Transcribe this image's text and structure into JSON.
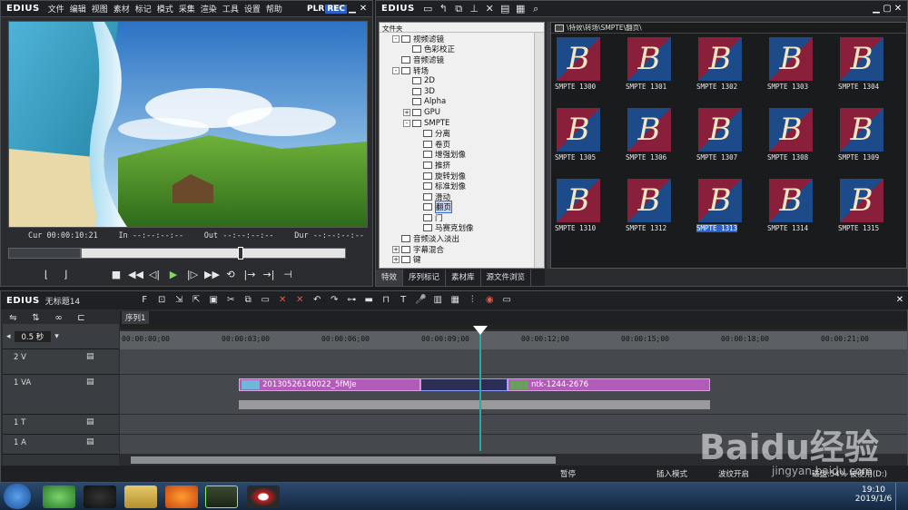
{
  "player": {
    "logo": "EDIUS",
    "menu": [
      "文件",
      "编辑",
      "视图",
      "素材",
      "标记",
      "模式",
      "采集",
      "渲染",
      "工具",
      "设置",
      "帮助"
    ],
    "plr": "PLR",
    "rec": "REC",
    "cur_label": "Cur",
    "cur_value": "00:00:10:21",
    "in_label": "In",
    "in_value": "--:--:--:--",
    "out_label": "Out",
    "out_value": "--:--:--:--",
    "dur_label": "Dur",
    "dur_value": "--:--:--:--",
    "scrub_position": 0.6
  },
  "bin": {
    "logo": "EDIUS",
    "tree_header": "文件夹",
    "path": "\\特效\\转场\\SMPTE\\翻页\\",
    "tree": [
      {
        "label": "视频滤镜",
        "level": 1,
        "exp": "-"
      },
      {
        "label": "色彩校正",
        "level": 2,
        "exp": ""
      },
      {
        "label": "音频滤镜",
        "level": 1,
        "exp": ""
      },
      {
        "label": "转场",
        "level": 1,
        "exp": "-"
      },
      {
        "label": "2D",
        "level": 2,
        "exp": ""
      },
      {
        "label": "3D",
        "level": 2,
        "exp": ""
      },
      {
        "label": "Alpha",
        "level": 2,
        "exp": ""
      },
      {
        "label": "GPU",
        "level": 2,
        "exp": "+"
      },
      {
        "label": "SMPTE",
        "level": 2,
        "exp": "-"
      },
      {
        "label": "分离",
        "level": 3,
        "exp": ""
      },
      {
        "label": "卷页",
        "level": 3,
        "exp": ""
      },
      {
        "label": "增强划像",
        "level": 3,
        "exp": ""
      },
      {
        "label": "推挤",
        "level": 3,
        "exp": ""
      },
      {
        "label": "旋转划像",
        "level": 3,
        "exp": ""
      },
      {
        "label": "标准划像",
        "level": 3,
        "exp": ""
      },
      {
        "label": "滑动",
        "level": 3,
        "exp": ""
      },
      {
        "label": "翻页",
        "level": 3,
        "exp": "",
        "selected": true
      },
      {
        "label": "门",
        "level": 3,
        "exp": ""
      },
      {
        "label": "马赛克划像",
        "level": 3,
        "exp": ""
      },
      {
        "label": "音频淡入淡出",
        "level": 1,
        "exp": ""
      },
      {
        "label": "字幕混合",
        "level": 1,
        "exp": "+"
      },
      {
        "label": "键",
        "level": 1,
        "exp": "+"
      }
    ],
    "tabs": [
      "特效",
      "序列标记",
      "素材库",
      "源文件浏览"
    ],
    "items": [
      {
        "label": "SMPTE 1300",
        "bg": "#1d4b8a",
        "fg": "#8a1f3c"
      },
      {
        "label": "SMPTE 1301",
        "bg": "#8a1f3c",
        "fg": "#1d4b8a"
      },
      {
        "label": "SMPTE 1302",
        "bg": "#8a1f3c",
        "fg": "#1d4b8a"
      },
      {
        "label": "SMPTE 1303",
        "bg": "#1d4b8a",
        "fg": "#8a1f3c"
      },
      {
        "label": "SMPTE 1304",
        "bg": "#8a1f3c",
        "fg": "#1d4b8a"
      },
      {
        "label": "SMPTE 1305",
        "bg": "#8a1f3c",
        "fg": "#1d4b8a"
      },
      {
        "label": "SMPTE 1306",
        "bg": "#1d4b8a",
        "fg": "#8a1f3c"
      },
      {
        "label": "SMPTE 1307",
        "bg": "#8a1f3c",
        "fg": "#1d4b8a"
      },
      {
        "label": "SMPTE 1308",
        "bg": "#1d4b8a",
        "fg": "#8a1f3c"
      },
      {
        "label": "SMPTE 1309",
        "bg": "#8a1f3c",
        "fg": "#1d4b8a"
      },
      {
        "label": "SMPTE 1310",
        "bg": "#1d4b8a",
        "fg": "#8a1f3c"
      },
      {
        "label": "SMPTE 1312",
        "bg": "#8a1f3c",
        "fg": "#1d4b8a"
      },
      {
        "label": "SMPTE 1313",
        "bg": "#8a1f3c",
        "fg": "#1d4b8a",
        "selected": true
      },
      {
        "label": "SMPTE 1314",
        "bg": "#8a1f3c",
        "fg": "#1d4b8a"
      },
      {
        "label": "SMPTE 1315",
        "bg": "#1d4b8a",
        "fg": "#8a1f3c"
      }
    ]
  },
  "timeline": {
    "logo": "EDIUS",
    "project": "无标题14",
    "sequence_tab": "序列1",
    "scale": "0.5 秒",
    "ruler": [
      "00:00:00;00",
      "00:00:03;00",
      "00:00:06;00",
      "00:00:09;00",
      "00:00:12;00",
      "00:00:15;00",
      "00:00:18;00",
      "00:00:21;00"
    ],
    "tracks": [
      {
        "name": "2 V"
      },
      {
        "name": "1 VA"
      },
      {
        "name": "1 T"
      },
      {
        "name": "1 A"
      }
    ],
    "clip1": "20130526140022_5fMJe",
    "clip2": "ntk-1244-2676",
    "status": {
      "state": "暂停",
      "mode": "插入模式",
      "ripple": "波纹开启",
      "disk": "磁盘:54% 被使用(D:)"
    }
  },
  "taskbar": {
    "time": "19:10",
    "date": "2019/1/6"
  },
  "watermark": "Baidu经验",
  "watermark_url": "jingyan.baidu.com"
}
